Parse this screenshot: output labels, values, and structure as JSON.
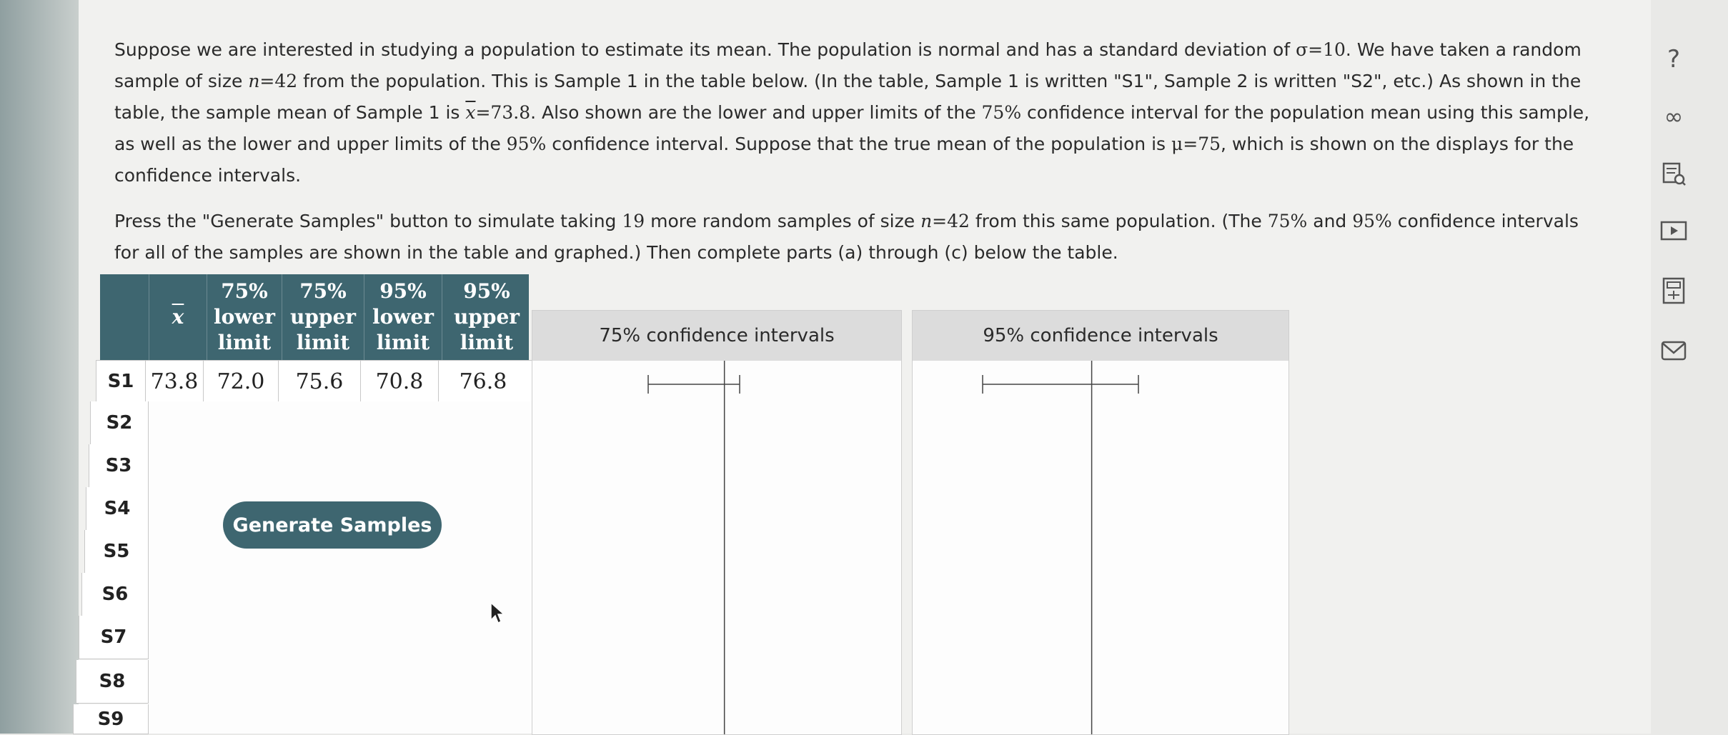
{
  "prompt": {
    "p1_a": "Suppose we are interested in studying a population to estimate its mean. The population is normal and has a standard deviation of ",
    "sigma_eq": "σ=10",
    "p1_b": ". We have taken a random sample of size ",
    "n_var": "n",
    "n_eq": "=42",
    "p1_c": " from the population. This is Sample 1 in the table below. (In the table, Sample 1 is written \"S1\", Sample 2 is written \"S2\", etc.) As shown in the table, the sample mean of Sample 1 is ",
    "xbar_var": "x",
    "xbar_eq": "=73.8",
    "p1_d": ". Also shown are the lower and upper limits of the ",
    "pct75": "75%",
    "p1_e": " confidence interval for the population mean using this sample, as well as the lower and upper limits of the ",
    "pct95": "95%",
    "p1_f": " confidence interval. Suppose that the true mean of the population is ",
    "mu_eq": "μ=75",
    "p1_g": ", which is shown on the displays for the confidence intervals.",
    "p2_a": "Press the \"Generate Samples\" button to simulate taking ",
    "nineteen": "19",
    "p2_b": " more random samples of size ",
    "p2_c": " from this same population. (The ",
    "p2_d": " and ",
    "p2_e": " confidence intervals for all of the samples are shown in the table and graphed.) Then complete parts (a) through (c) below the table."
  },
  "table": {
    "headers": {
      "xbar": "x",
      "h1": [
        "75%",
        "lower",
        "limit"
      ],
      "h2": [
        "75%",
        "upper",
        "limit"
      ],
      "h3": [
        "95%",
        "lower",
        "limit"
      ],
      "h4": [
        "95%",
        "upper",
        "limit"
      ]
    },
    "row1": {
      "label": "S1",
      "xbar": "73.8",
      "l75": "72.0",
      "u75": "75.6",
      "l95": "70.8",
      "u95": "76.8"
    },
    "row_labels": [
      "S2",
      "S3",
      "S4",
      "S5",
      "S6",
      "S7",
      "S8",
      "S9"
    ]
  },
  "generate_button": "Generate Samples",
  "panels": {
    "p75": {
      "title": "75% confidence intervals",
      "lower": 72.0,
      "upper": 75.6,
      "mu": 75
    },
    "p95": {
      "title": "95% confidence intervals",
      "lower": 70.8,
      "upper": 76.8,
      "mu": 75
    }
  },
  "toolbar": {
    "help": "?",
    "infinity": "∞"
  }
}
